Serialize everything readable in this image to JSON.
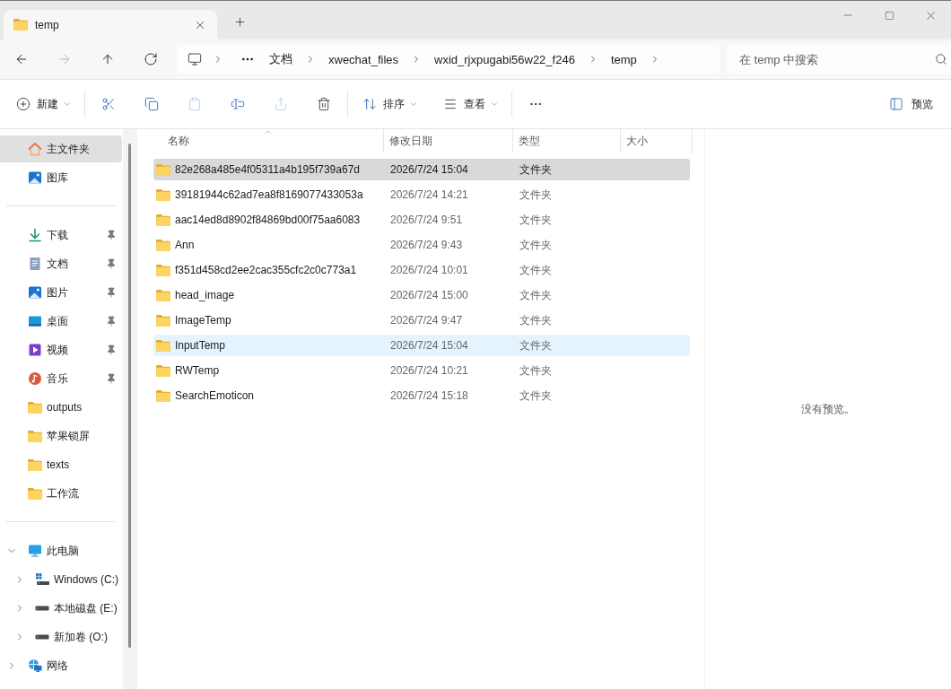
{
  "tabs": [
    {
      "label": "temp",
      "selected": true
    }
  ],
  "nav_buttons": [
    {
      "kind": "back",
      "disabled": false
    },
    {
      "kind": "forward",
      "disabled": true
    },
    {
      "kind": "up",
      "disabled": false
    },
    {
      "kind": "refresh",
      "disabled": false
    }
  ],
  "address_bar": {
    "segments": [
      "文档",
      "xwechat_files",
      "wxid_rjxpugabi56w22_f246",
      "temp"
    ]
  },
  "search": {
    "placeholder": "在 temp 中搜索"
  },
  "toolbar": {
    "groups": [
      [
        {
          "kind": "new",
          "label": "新建",
          "disabled": false
        }
      ],
      [
        {
          "kind": "cut",
          "disabled": false
        },
        {
          "kind": "copy",
          "disabled": false
        },
        {
          "kind": "paste",
          "disabled": true
        },
        {
          "kind": "rename",
          "disabled": false
        },
        {
          "kind": "share",
          "disabled": true
        },
        {
          "kind": "delete",
          "disabled": false
        }
      ],
      [
        {
          "kind": "sort",
          "label": "排序",
          "disabled": false
        },
        {
          "kind": "view",
          "label": "查看",
          "disabled": false
        }
      ],
      [
        {
          "kind": "more",
          "disabled": false
        }
      ]
    ],
    "preview_button": {
      "label": "预览"
    }
  },
  "sidebar": {
    "sections": [
      {
        "items": [
          {
            "kind": "home",
            "label": "主文件夹",
            "selected": true
          },
          {
            "kind": "gallery",
            "label": "图库",
            "selected": false
          }
        ]
      },
      {
        "items": [
          {
            "kind": "downloads",
            "label": "下载",
            "pinned": true,
            "selected": false
          },
          {
            "kind": "documents",
            "label": "文档",
            "pinned": true,
            "selected": false
          },
          {
            "kind": "pictures",
            "label": "图片",
            "pinned": true,
            "selected": false
          },
          {
            "kind": "desktop",
            "label": "桌面",
            "pinned": true,
            "selected": false
          },
          {
            "kind": "videos",
            "label": "视频",
            "pinned": true,
            "selected": false
          },
          {
            "kind": "music",
            "label": "音乐",
            "pinned": true,
            "selected": false
          },
          {
            "kind": "folder",
            "label": "outputs",
            "pinned": false,
            "selected": false
          },
          {
            "kind": "folder",
            "label": "苹果锁屏",
            "pinned": false,
            "selected": false
          },
          {
            "kind": "folder",
            "label": "texts",
            "pinned": false,
            "selected": false
          },
          {
            "kind": "folder",
            "label": "工作流",
            "pinned": false,
            "selected": false
          }
        ]
      },
      {
        "items": [
          {
            "kind": "pc",
            "label": "此电脑",
            "expanded": true,
            "selected": false,
            "children": [
              {
                "kind": "system_drive",
                "label": "Windows (C:)",
                "expanded": false,
                "selected": false
              },
              {
                "kind": "drive",
                "label": "本地磁盘 (E:)",
                "expanded": false,
                "selected": false
              },
              {
                "kind": "drive",
                "label": "新加卷 (O:)",
                "expanded": false,
                "selected": false
              }
            ]
          },
          {
            "kind": "network",
            "label": "网络",
            "expanded": false,
            "selected": false
          }
        ]
      }
    ]
  },
  "columns": [
    {
      "label": "名称",
      "sorted": true
    },
    {
      "label": "修改日期",
      "sorted": false
    },
    {
      "label": "类型",
      "sorted": false
    },
    {
      "label": "大小",
      "sorted": false
    }
  ],
  "rows": [
    {
      "name": "82e268a485e4f05311a4b195f739a67d",
      "modified": "2026/7/24 15:04",
      "type": "文件夹",
      "selected": true,
      "hovered": false
    },
    {
      "name": "39181944c62ad7ea8f8169077433053a",
      "modified": "2026/7/24 14:21",
      "type": "文件夹",
      "selected": false,
      "hovered": false
    },
    {
      "name": "aac14ed8d8902f84869bd00f75aa6083",
      "modified": "2026/7/24 9:51",
      "type": "文件夹",
      "selected": false,
      "hovered": false
    },
    {
      "name": "Ann",
      "modified": "2026/7/24 9:43",
      "type": "文件夹",
      "selected": false,
      "hovered": false
    },
    {
      "name": "f351d458cd2ee2cac355cfc2c0c773a1",
      "modified": "2026/7/24 10:01",
      "type": "文件夹",
      "selected": false,
      "hovered": false
    },
    {
      "name": "head_image",
      "modified": "2026/7/24 15:00",
      "type": "文件夹",
      "selected": false,
      "hovered": false
    },
    {
      "name": "ImageTemp",
      "modified": "2026/7/24 9:47",
      "type": "文件夹",
      "selected": false,
      "hovered": false
    },
    {
      "name": "InputTemp",
      "modified": "2026/7/24 15:04",
      "type": "文件夹",
      "selected": false,
      "hovered": true
    },
    {
      "name": "RWTemp",
      "modified": "2026/7/24 10:21",
      "type": "文件夹",
      "selected": false,
      "hovered": false
    },
    {
      "name": "SearchEmoticon",
      "modified": "2026/7/24 15:18",
      "type": "文件夹",
      "selected": false,
      "hovered": false
    }
  ],
  "preview_pane": {
    "message": "没有预览。"
  }
}
